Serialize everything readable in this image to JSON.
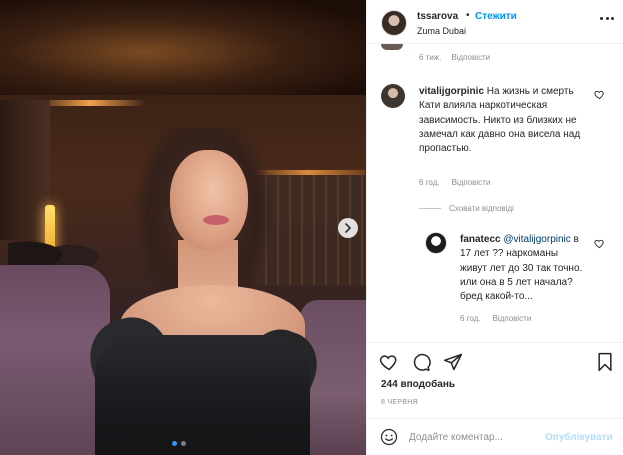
{
  "post": {
    "username": "tssarova",
    "separator": "•",
    "follow_label": "Стежити",
    "location": "Zuma Dubai",
    "slides": {
      "count": 2,
      "active": 1
    }
  },
  "previous_comment": {
    "time": "6 тиж.",
    "reply_label": "Відповісти"
  },
  "comments": [
    {
      "username": "vitalijgorpinic",
      "text": "На жизнь и смерть Кати влияла наркотическая зависимость. Никто из близких не замечал как давно она висела над пропастью.",
      "time": "6 год.",
      "reply_label": "Відповісти"
    }
  ],
  "hide_replies_label": "Сховати відповіді",
  "replies": [
    {
      "username": "fanatecc",
      "mention": "@vitalijgorpinic",
      "text": "в 17 лет ?? наркоманы живут лет до 30 так точно. или она в 5 лет начала? бред какой-то...",
      "time": "6 год.",
      "reply_label": "Відповісти"
    }
  ],
  "likes_text": "244 вподобань",
  "date_text": "8 червня",
  "comment_box": {
    "placeholder": "Додайте коментар...",
    "publish_label": "Опублікувати"
  },
  "icons": {
    "more": "more-options-icon",
    "like": "heart-icon",
    "comment": "comment-icon",
    "share": "share-icon",
    "save": "bookmark-icon",
    "emoji": "emoji-icon",
    "next": "chevron-right-icon"
  },
  "colors": {
    "accent": "#0095f6",
    "publish_disabled": "#b2dffc",
    "meta": "#8e8e8e"
  }
}
